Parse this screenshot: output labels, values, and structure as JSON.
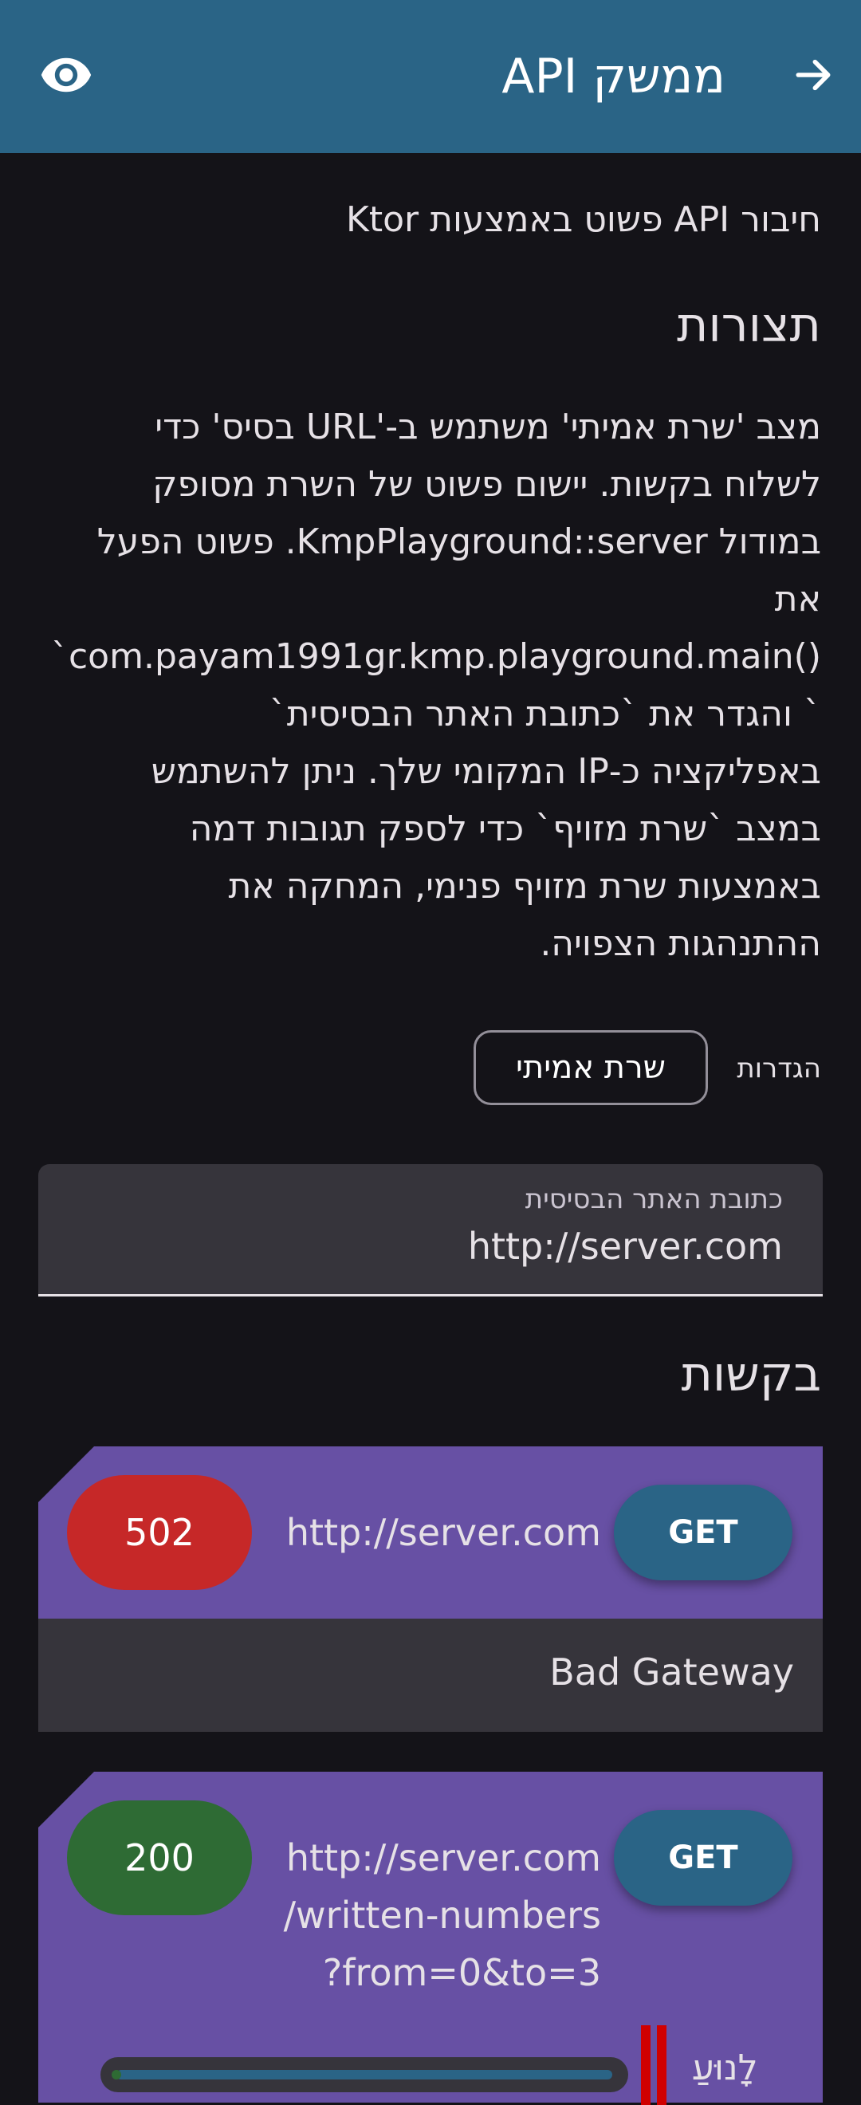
{
  "app_bar": {
    "title": "ממשק API",
    "back_icon": "arrow-back-icon",
    "visibility_icon": "eye-icon",
    "color": "#2a6486"
  },
  "subtitle": "חיבור API פשוט באמצעות Ktor",
  "config": {
    "heading": "תצורות",
    "description_lines": [
      "מצב 'שרת אמיתי' משתמש ב-'URL בסיס' כדי",
      "לשלוח בקשות. יישום פשוט של השרת מסופק",
      "במודול KmpPlayground::server. פשוט הפעל",
      "את",
      "`com.payam1991gr.kmp.playground.main()",
      "` והגדר את `כתובת האתר הבסיסית`",
      "באפליקציה כ-IP המקומי שלך. ניתן להשתמש",
      "במצב `שרת מזויף` כדי לספק תגובות דמה",
      "באמצעות שרת מזויף פנימי, המחקה את",
      "ההתנהגות הצפויה."
    ],
    "settings_label": "הגדרות",
    "server_mode_button": "שרת אמיתי",
    "base_url_label": "כתובת האתר הבסיסית",
    "base_url_value": "http://server.com"
  },
  "requests": {
    "heading": "בקשות",
    "items": [
      {
        "method": "GET",
        "url_lines": [
          "http://server.com"
        ],
        "status": "502",
        "status_color": "#c62828",
        "response": "Bad Gateway"
      },
      {
        "method": "GET",
        "url_lines": [
          "http://server.com",
          "/written-numbers",
          "?from=0&to=3"
        ],
        "status": "200",
        "status_color": "#2e6b34",
        "progress_label": "לָנוּעַ"
      }
    ]
  },
  "colors": {
    "background": "#141318",
    "card": "#6750a4",
    "surface": "#36343b",
    "pause": "#d00000"
  }
}
